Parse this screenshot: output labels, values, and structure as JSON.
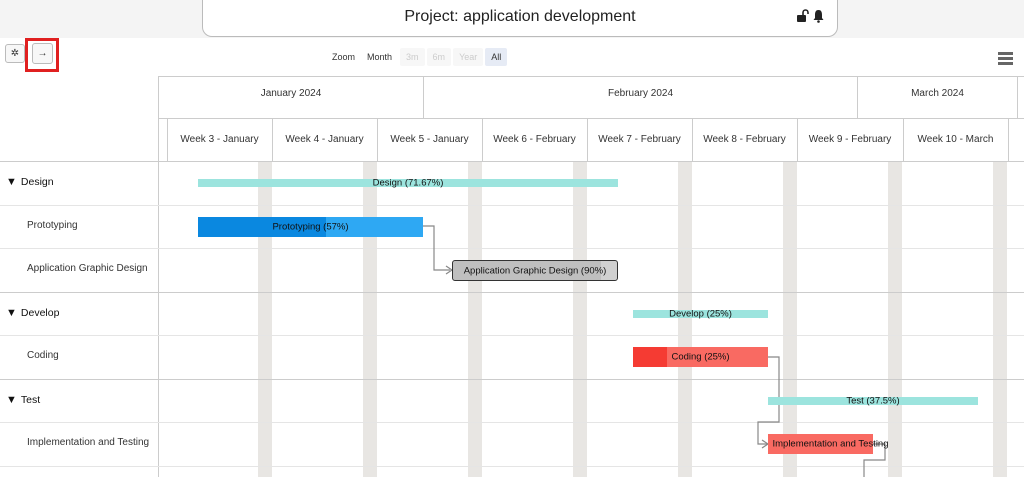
{
  "header": {
    "title": "Project: application development"
  },
  "toolbar": {
    "settings_icon": "gear-icon",
    "arrow_icon": "arrow-right-icon"
  },
  "zoom": {
    "label": "Zoom",
    "options": [
      "Month",
      "3m",
      "6m",
      "Year",
      "All"
    ],
    "selected": "All"
  },
  "timeline": {
    "months": [
      "January 2024",
      "February 2024",
      "March 2024"
    ],
    "weeks": [
      "Week 3 - January",
      "Week 4 - January",
      "Week 5 - January",
      "Week 6 - February",
      "Week 7 - February",
      "Week 8 - February",
      "Week 9 - February",
      "Week 10 - March"
    ]
  },
  "rows": [
    {
      "label": "Design",
      "type": "parent"
    },
    {
      "label": "Prototyping",
      "type": "child"
    },
    {
      "label": "Application Graphic Design",
      "type": "child"
    },
    {
      "label": "Develop",
      "type": "parent"
    },
    {
      "label": "Coding",
      "type": "child"
    },
    {
      "label": "Test",
      "type": "parent"
    },
    {
      "label": "Implementation and Testing",
      "type": "child"
    }
  ],
  "bars": [
    {
      "label": "Design (71.67%)",
      "progress": 71.67,
      "color": "#9ce4de"
    },
    {
      "label": "Prototyping (57%)",
      "progress": 57,
      "color": "#2ea8f3",
      "fill_color": "#0a88e0"
    },
    {
      "label": "Application Graphic Design (90%)",
      "progress": 90,
      "color": "#d0d0d0"
    },
    {
      "label": "Develop (25%)",
      "progress": 25,
      "color": "#9ce4de"
    },
    {
      "label": "Coding (25%)",
      "progress": 25,
      "color": "#f96a62",
      "fill_color": "#f53b33"
    },
    {
      "label": "Test (37.5%)",
      "progress": 37.5,
      "color": "#9ce4de"
    },
    {
      "label": "Implementation and Testing",
      "progress": 0,
      "color": "#f96a62"
    }
  ]
}
